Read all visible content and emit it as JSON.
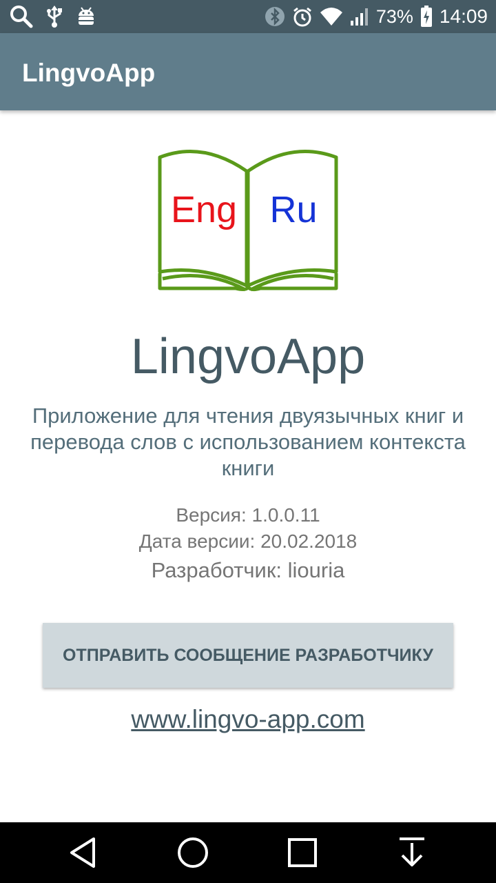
{
  "status_bar": {
    "left_icons": [
      "search-icon",
      "usb-icon",
      "android-debug-icon"
    ],
    "right_icons": [
      "bluetooth-icon",
      "alarm-icon",
      "wifi-icon",
      "signal-icon",
      "battery-charging-icon"
    ],
    "battery": "73%",
    "time": "14:09"
  },
  "app_bar": {
    "title": "LingvoApp"
  },
  "logo": {
    "left_text": "Eng",
    "right_text": "Ru",
    "left_color": "#e8141b",
    "right_color": "#1533d6",
    "book_color": "#5a9a1a"
  },
  "about": {
    "app_name": "LingvoApp",
    "description": "Приложение для чтения двуязычных книг и перевода слов с использованием контекста книги",
    "version": "Версия: 1.0.0.11",
    "version_date": "Дата версии: 20.02.2018",
    "developer": "Разработчик: liouria",
    "send_button": "ОТПРАВИТЬ СООБЩЕНИЕ РАЗРАБОТЧИКУ",
    "website": "www.lingvo-app.com"
  },
  "nav_bar": {
    "buttons": [
      "back-icon",
      "home-icon",
      "recents-icon",
      "download-icon"
    ]
  },
  "colors": {
    "status_bar": "#455a64",
    "app_bar": "#607d8b",
    "primary_text": "#455a64",
    "button_bg": "#cfd8dc"
  }
}
